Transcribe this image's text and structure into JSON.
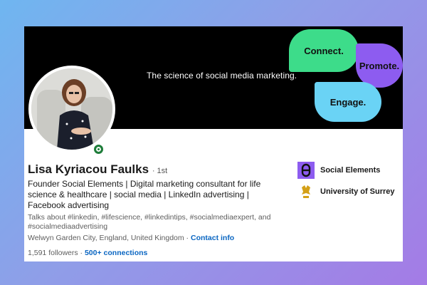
{
  "banner": {
    "tagline": "The science of social media marketing.",
    "bubbles": {
      "connect": "Connect.",
      "promote": "Promote.",
      "engage": "Engage."
    }
  },
  "profile": {
    "name": "Lisa Kyriacou Faulks",
    "degree": "· 1st",
    "headline": "Founder Social Elements | Digital marketing consultant for life science & healthcare | social media | LinkedIn advertising | Facebook advertising",
    "talks_about": "Talks about #linkedin, #lifescience, #linkedintips, #socialmediaexpert, and #socialmediaadvertising",
    "location": "Welwyn Garden City, England, United Kingdom ·",
    "contact_info": "Contact info",
    "followers": "1,591 followers",
    "separator": " · ",
    "connections": "500+ connections",
    "status": "online"
  },
  "organizations": [
    {
      "name": "Social Elements",
      "icon": "social-elements-logo"
    },
    {
      "name": "University of Surrey",
      "icon": "university-crest"
    }
  ],
  "colors": {
    "connect": "#3ddc8a",
    "promote": "#8d5cf0",
    "engage": "#6ad3f5",
    "link": "#0a66c2",
    "status": "#1e7d3a"
  }
}
